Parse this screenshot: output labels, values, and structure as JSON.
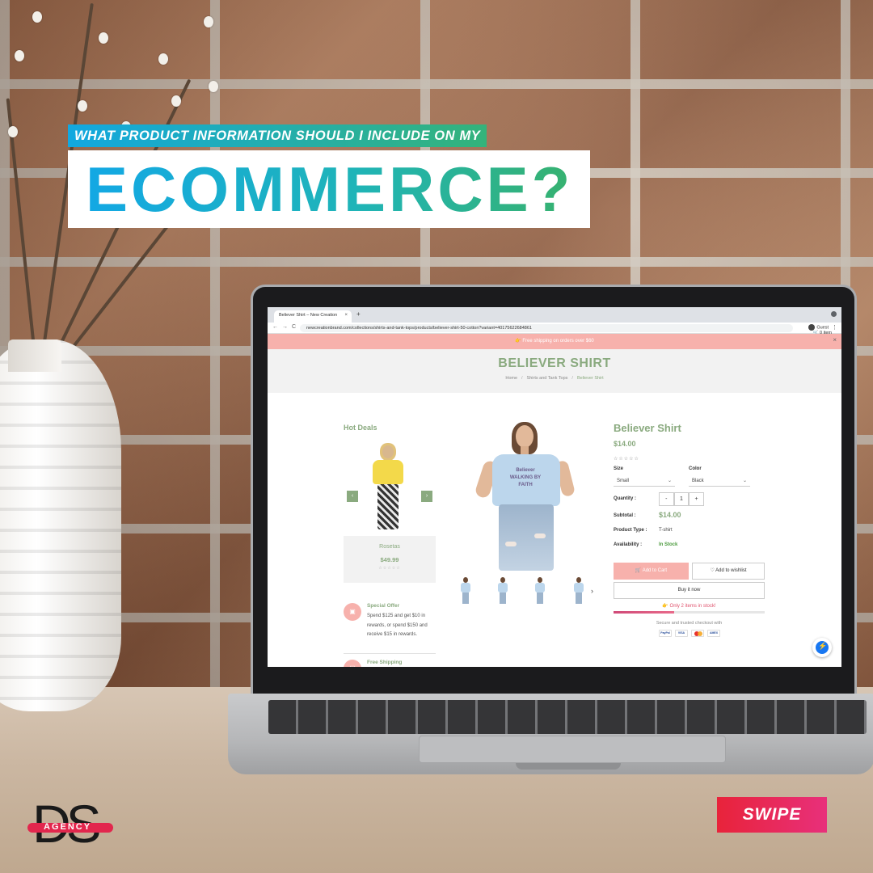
{
  "headline": {
    "question": "WHAT PRODUCT INFORMATION SHOULD I INCLUDE ON MY",
    "keyword": "ECOMMERCE?"
  },
  "browser": {
    "tab_title": "Believer Shirt – New Creation",
    "tab_close": "×",
    "new_tab": "+",
    "url": "newcreationbrand.com/collections/shirts-and-tank-tops/products/believer-shirt-50-cotton?variant=40175622684861",
    "profile_label": "Guest",
    "back": "←",
    "forward": "→",
    "reload": "C",
    "kebab": "⋮"
  },
  "store": {
    "promo_text": "Free shipping on orders over $60",
    "cart_label": "0 item",
    "promo_close": "×",
    "page_title": "BELIEVER SHIRT",
    "breadcrumbs": [
      "Home",
      "Shirts and Tank Tops",
      "Believer Shirt"
    ],
    "breadcrumb_sep": "/",
    "sidebar": {
      "title": "Hot Deals",
      "deal": {
        "name": "Rosetas",
        "price": "$49.99",
        "stars": "☆☆☆☆☆",
        "prev": "‹",
        "next": "›"
      },
      "features": [
        {
          "icon": "gift-icon",
          "glyph": "▣",
          "title": "Special Offer",
          "text": "Spend $125 and get $10 in rewards, or spend $150 and receive $15 in rewards."
        },
        {
          "icon": "truck-icon",
          "glyph": "▤",
          "title": "Free Shipping",
          "text": ""
        }
      ]
    },
    "gallery": {
      "next": "›",
      "print_line1": "Believer",
      "print_line2": "WALKING BY FAITH"
    },
    "product": {
      "title": "Believer Shirt",
      "price": "$14.00",
      "stars": "☆☆☆☆☆",
      "size_label": "Size",
      "size_value": "Small",
      "color_label": "Color",
      "color_value": "Black",
      "quantity_label": "Quantity :",
      "qty_minus": "-",
      "qty_value": "1",
      "qty_plus": "+",
      "subtotal_label": "Subtotal :",
      "subtotal_value": "$14.00",
      "type_label": "Product Type :",
      "type_value": "T-shirt",
      "availability_label": "Availability :",
      "availability_value": "In Stock",
      "add_to_cart": "Add to Cart",
      "add_to_wishlist": "Add to wishlist",
      "buy_now": "Buy it now",
      "low_stock": "Only 2 items in stock!",
      "stock_fraction": 0.4,
      "secure_text": "Secure and trusted checkout with",
      "payments": [
        "PayPal",
        "VISA",
        "",
        "AMEX"
      ]
    },
    "colors": {
      "accent": "#8aaa7f",
      "promo": "#f7b1ac",
      "stock": "#4a9a3c"
    }
  },
  "branding": {
    "logo_letters": "DS",
    "logo_word": "AGENCY",
    "swipe": "SWIPE",
    "colors": {
      "headline_from": "#12a8e0",
      "headline_to": "#37b26f",
      "swipe": "#e8233a"
    }
  }
}
